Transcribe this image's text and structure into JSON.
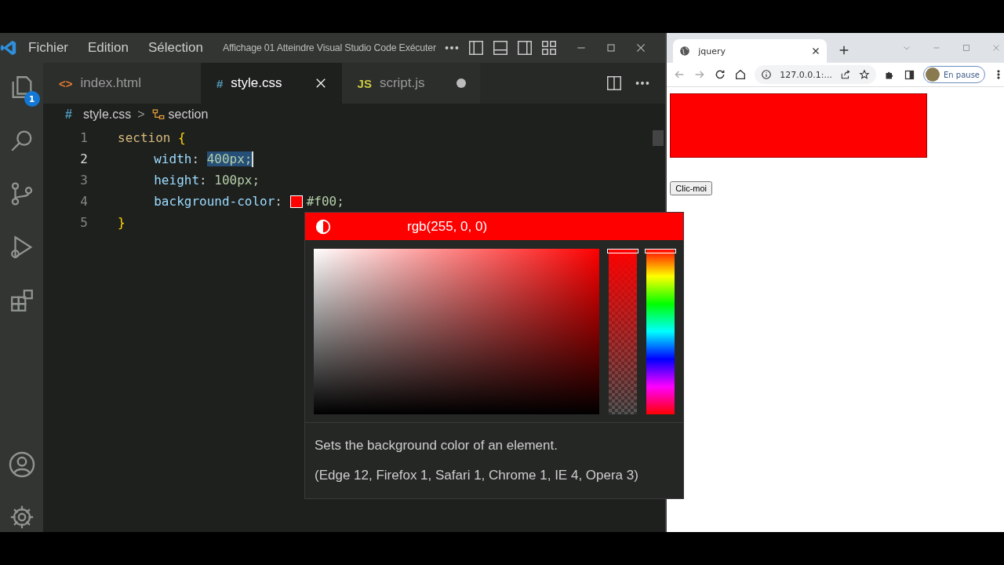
{
  "vscode": {
    "menu": [
      "Fichier",
      "Edition",
      "Sélection"
    ],
    "title": "Affichage 01 Atteindre Visual Studio Code Exécuter",
    "activity_badge": "1",
    "tabs": [
      {
        "icon_text": "<>",
        "kind": "html",
        "label": "index.html",
        "selected": false,
        "modified": false
      },
      {
        "icon_text": "#",
        "kind": "css",
        "label": "style.css",
        "selected": true,
        "modified": false
      },
      {
        "icon_text": "JS",
        "kind": "js",
        "label": "script.js",
        "selected": false,
        "modified": true
      }
    ],
    "breadcrumb": {
      "file_icon": "#",
      "file": "style.css",
      "separator": ">",
      "symbol": "section"
    },
    "lines": [
      {
        "number": "1",
        "current": false,
        "tokens": [
          {
            "kind": "sel",
            "text": "section "
          },
          {
            "kind": "brace",
            "text": "{"
          }
        ]
      },
      {
        "number": "2",
        "current": true,
        "tokens": [
          {
            "kind": "indent"
          },
          {
            "kind": "prop",
            "text": "width"
          },
          {
            "kind": "punct",
            "text": ": "
          },
          {
            "kind": "value",
            "text": "400px;",
            "selected": true
          }
        ]
      },
      {
        "number": "3",
        "current": false,
        "tokens": [
          {
            "kind": "indent"
          },
          {
            "kind": "prop",
            "text": "height"
          },
          {
            "kind": "punct",
            "text": ": "
          },
          {
            "kind": "value",
            "text": "100px;"
          }
        ]
      },
      {
        "number": "4",
        "current": false,
        "tokens": [
          {
            "kind": "indent"
          },
          {
            "kind": "prop",
            "text": "background-color"
          },
          {
            "kind": "punct",
            "text": ": "
          },
          {
            "kind": "swatch",
            "color": "#ff0000"
          },
          {
            "kind": "value",
            "text": "#f00;"
          }
        ]
      },
      {
        "number": "5",
        "current": false,
        "tokens": [
          {
            "kind": "brace",
            "text": "}"
          }
        ]
      }
    ],
    "color_picker": {
      "color": "#ff0000",
      "label": "rgb(255, 0, 0)",
      "opacity_slider": {
        "level": 0
      },
      "hue_slider": {
        "level": 0
      }
    },
    "hover": [
      "Sets the background color of an element.",
      "(Edge 12, Firefox 1, Safari 1, Chrome 1, IE 4, Opera 3)"
    ]
  },
  "browser": {
    "tab": {
      "title": "jquery"
    },
    "address": "127.0.0.1:...",
    "profile": "En pause",
    "button": "Clic-moi"
  }
}
